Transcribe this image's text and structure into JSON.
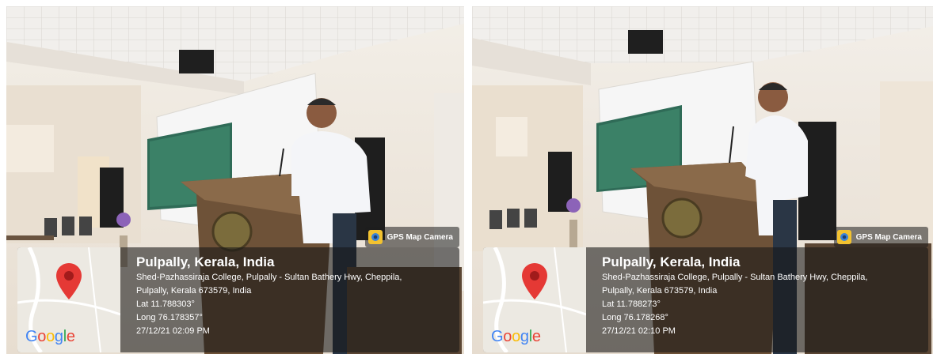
{
  "photos": [
    {
      "camera_label": "GPS Map Camera",
      "map_brand": "Google",
      "location": "Pulpally, Kerala, India",
      "address_line1": "Shed-Pazhassiraja College, Pulpally - Sultan Bathery Hwy, Cheppila,",
      "address_line2": "Pulpally, Kerala 673579, India",
      "lat": "Lat 11.788303°",
      "long": "Long 76.178357°",
      "timestamp": "27/12/21 02:09 PM"
    },
    {
      "camera_label": "GPS Map Camera",
      "map_brand": "Google",
      "location": "Pulpally, Kerala, India",
      "address_line1": "Shed-Pazhassiraja College, Pulpally - Sultan Bathery Hwy, Cheppila,",
      "address_line2": "Pulpally, Kerala 673579, India",
      "lat": "Lat 11.788273°",
      "long": "Long 76.178268°",
      "timestamp": "27/12/21 02:10 PM"
    }
  ],
  "colors": {
    "pin_red": "#e53935",
    "overlay_bg": "#161616",
    "wall": "#efe8dd",
    "podium": "#6e5238"
  },
  "icons": [
    "camera-app-icon",
    "map-pin-icon"
  ]
}
